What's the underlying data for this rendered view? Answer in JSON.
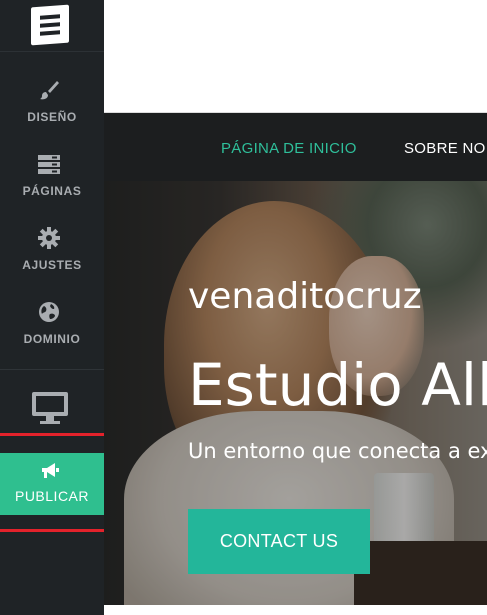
{
  "sidebar": {
    "items": [
      {
        "icon": "paintbrush-icon",
        "label": "DISEÑO"
      },
      {
        "icon": "pages-icon",
        "label": "PÁGINAS"
      },
      {
        "icon": "gear-icon",
        "label": "AJUSTES"
      },
      {
        "icon": "globe-icon",
        "label": "DOMINIO"
      }
    ],
    "device_icon": "desktop-monitor-icon",
    "publish": {
      "icon": "megaphone-icon",
      "label": "PUBLICAR"
    }
  },
  "site": {
    "nav": {
      "active": "PÁGINA DE INICIO",
      "next": "SOBRE NO"
    },
    "hero": {
      "brand": "venaditocruz",
      "title": "Estudio Alli",
      "subtitle": "Un entorno que conecta a ex",
      "cta": "CONTACT US"
    }
  },
  "colors": {
    "sidebar_bg": "#1f2326",
    "accent": "#2fbf8f",
    "cta": "#23b69a",
    "nav_active": "#2fbf9a",
    "highlight": "#e3222b"
  }
}
